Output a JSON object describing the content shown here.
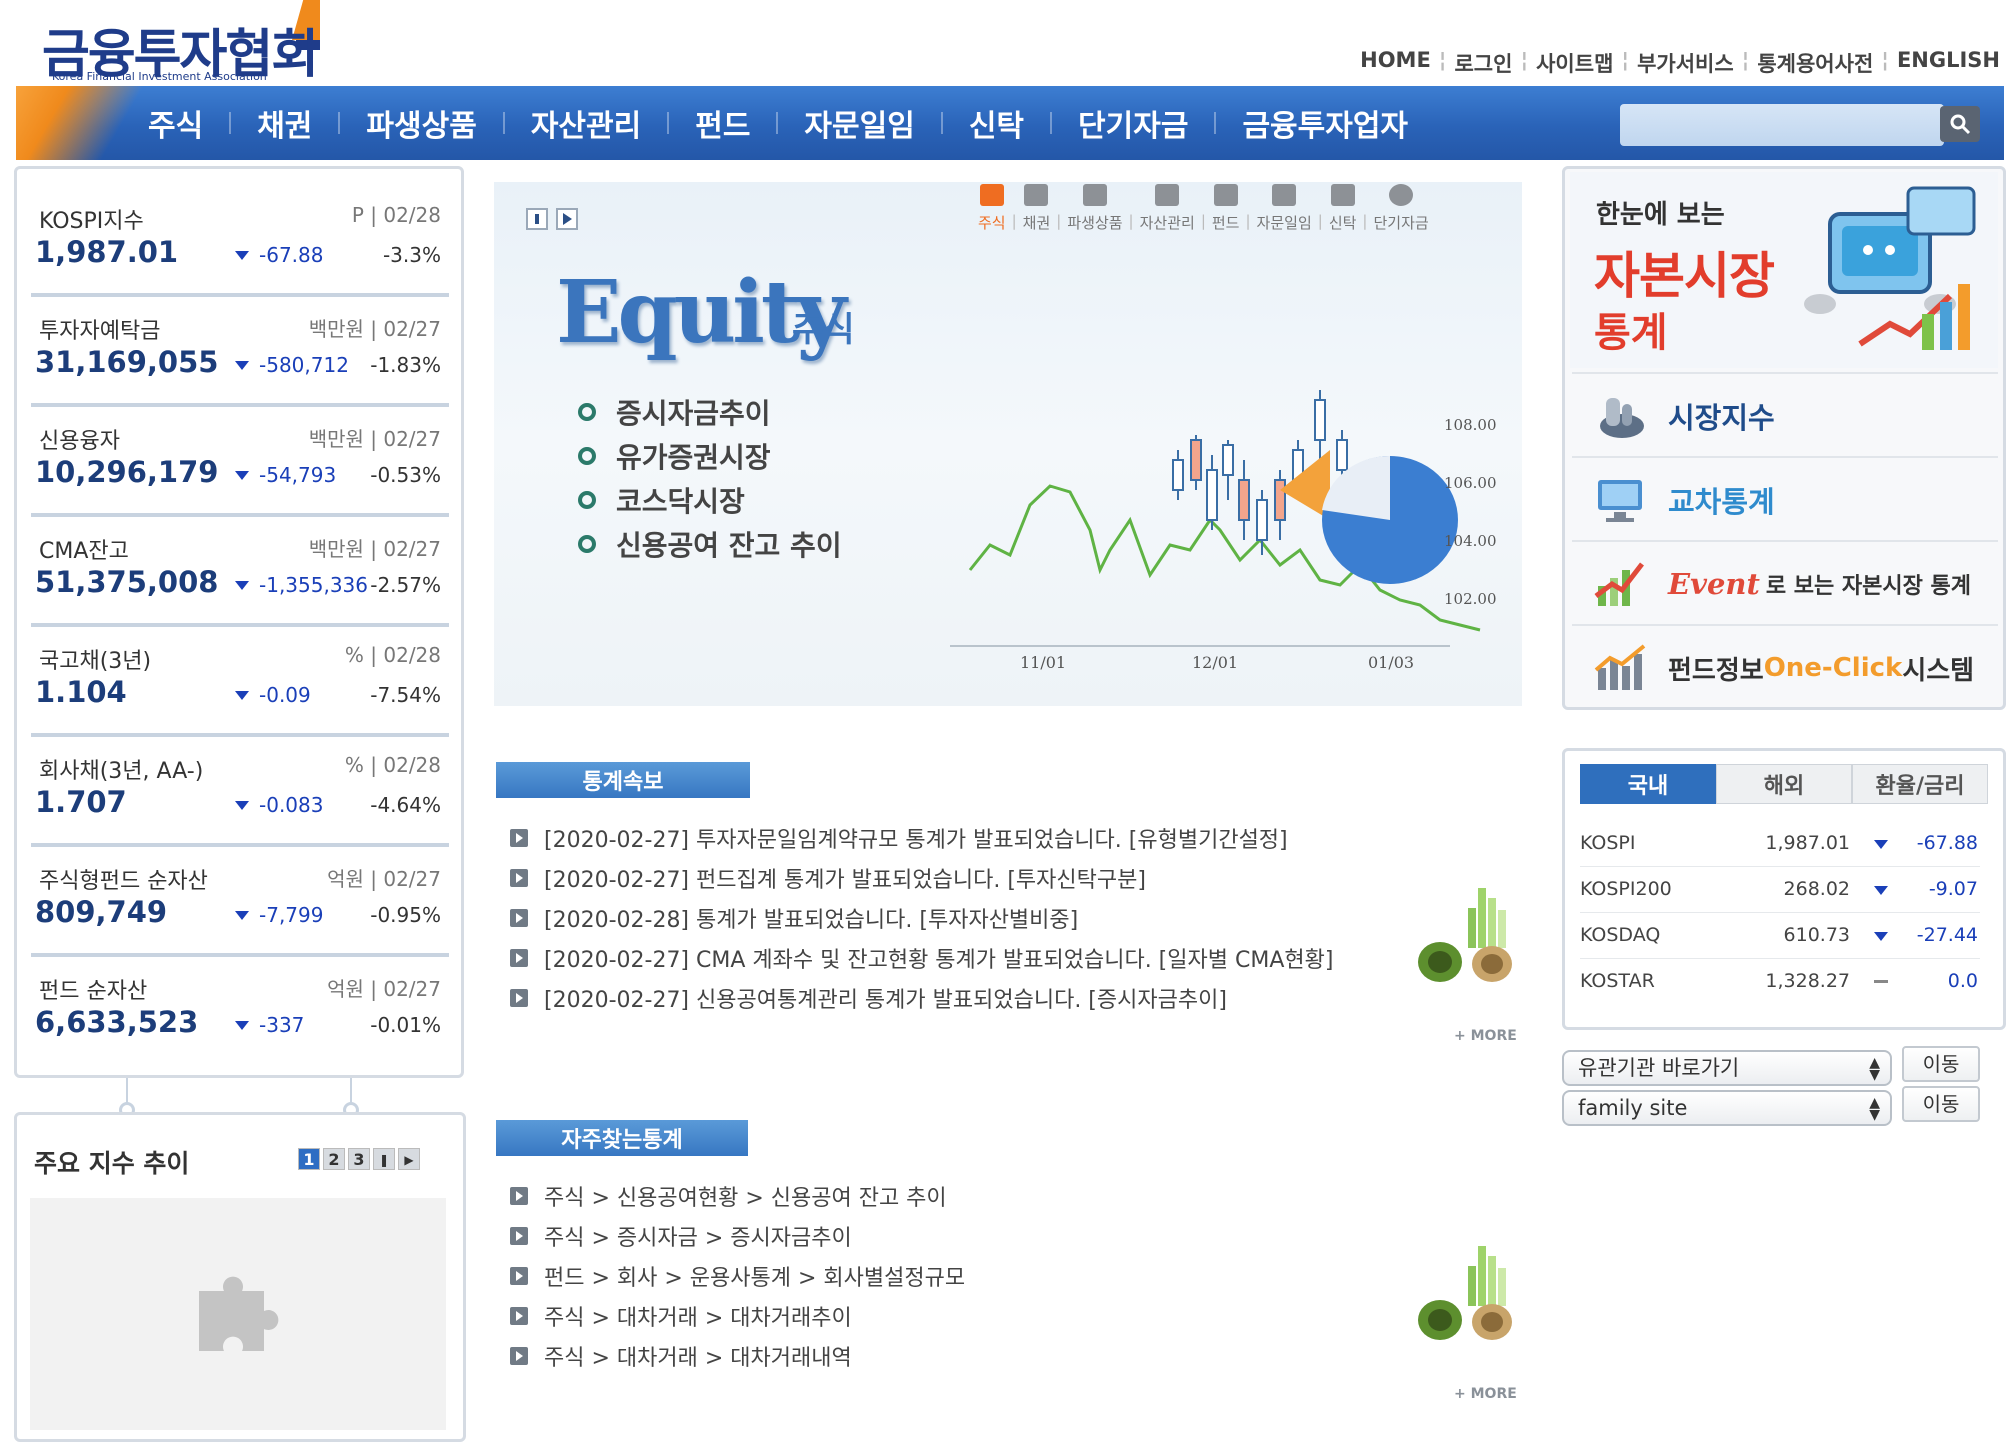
{
  "header": {
    "logo_text": "금융투자협회",
    "logo_sub": "Korea Financial Investment Association",
    "util_nav": [
      "HOME",
      "로그인",
      "사이트맵",
      "부가서비스",
      "통계용어사전",
      "ENGLISH"
    ]
  },
  "gnb": [
    "주식",
    "채권",
    "파생상품",
    "자산관리",
    "펀드",
    "자문일임",
    "신탁",
    "단기자금",
    "금융투자업자"
  ],
  "stats": [
    {
      "name": "KOSPI지수",
      "meta": "P | 02/28",
      "value": "1,987.01",
      "change": "-67.88",
      "pct": "-3.3%"
    },
    {
      "name": "투자자예탁금",
      "meta": "백만원 | 02/27",
      "value": "31,169,055",
      "change": "-580,712",
      "pct": "-1.83%"
    },
    {
      "name": "신용융자",
      "meta": "백만원 | 02/27",
      "value": "10,296,179",
      "change": "-54,793",
      "pct": "-0.53%"
    },
    {
      "name": "CMA잔고",
      "meta": "백만원 | 02/27",
      "value": "51,375,008",
      "change": "-1,355,336",
      "pct": "-2.57%"
    },
    {
      "name": "국고채(3년)",
      "meta": "% | 02/28",
      "value": "1.104",
      "change": "-0.09",
      "pct": "-7.54%"
    },
    {
      "name": "회사채(3년, AA-)",
      "meta": "% | 02/28",
      "value": "1.707",
      "change": "-0.083",
      "pct": "-4.64%"
    },
    {
      "name": "주식형펀드 순자산",
      "meta": "억원 | 02/27",
      "value": "809,749",
      "change": "-7,799",
      "pct": "-0.95%"
    },
    {
      "name": "펀드 순자산",
      "meta": "억원 | 02/27",
      "value": "6,633,523",
      "change": "-337",
      "pct": "-0.01%"
    }
  ],
  "trend": {
    "title": "주요 지수 추이",
    "pages": [
      "1",
      "2",
      "3"
    ]
  },
  "banner": {
    "categories": [
      "주식",
      "채권",
      "파생상품",
      "자산관리",
      "펀드",
      "자문일임",
      "신탁",
      "단기자금"
    ],
    "title": "Equity",
    "subtitle": "주식",
    "links": [
      "증시자금추이",
      "유가증권시장",
      "코스닥시장",
      "신용공여 잔고 추이"
    ],
    "chart_y_ticks": [
      "108.00",
      "106.00",
      "104.00",
      "102.00"
    ],
    "chart_x_ticks": [
      "11/01",
      "12/01",
      "01/03"
    ]
  },
  "news": {
    "title": "통계속보",
    "items": [
      "[2020-02-27] 투자자문일임계약규모 통계가 발표되었습니다. [유형별기간설정]",
      "[2020-02-27] 펀드집계 통계가 발표되었습니다. [투자신탁구분]",
      "[2020-02-28] 통계가 발표되었습니다. [투자자산별비중]",
      "[2020-02-27] CMA 계좌수 및 잔고현황 통계가 발표되었습니다. [일자별 CMA현황]",
      "[2020-02-27] 신용공여통계관리 통계가 발표되었습니다. [증시자금추이]"
    ],
    "more": "+ MORE"
  },
  "frequent": {
    "title": "자주찾는통계",
    "items": [
      "주식 > 신용공여현황 > 신용공여 잔고 추이",
      "주식 > 증시자금 > 증시자금추이",
      "펀드 > 회사 > 운용사통계 > 회사별설정규모",
      "주식 > 대차거래 > 대차거래추이",
      "주식 > 대차거래 > 대차거래내역"
    ],
    "more": "+ MORE"
  },
  "promo": {
    "small": "한눈에 보는",
    "big": "자본시장",
    "big2": "통계",
    "items": [
      "시장지수",
      "교차통계",
      "Event",
      "로 보는 자본시장 통계",
      "펀드정보",
      "One-Click",
      "시스템"
    ]
  },
  "market": {
    "tabs": [
      "국내",
      "해외",
      "환율/금리"
    ],
    "rows": [
      {
        "name": "KOSPI",
        "value": "1,987.01",
        "change": "-67.88"
      },
      {
        "name": "KOSPI200",
        "value": "268.02",
        "change": "-9.07"
      },
      {
        "name": "KOSDAQ",
        "value": "610.73",
        "change": "-27.44"
      },
      {
        "name": "KOSTAR",
        "value": "1,328.27",
        "change": "0.0"
      }
    ]
  },
  "selects": {
    "related": "유관기관 바로가기",
    "family": "family site",
    "go": "이동"
  },
  "colors": {
    "brand_blue": "#2a63b8",
    "accent_orange": "#f08a1c",
    "down_blue": "#1a3fb8",
    "promo_red": "#e23d2c"
  }
}
